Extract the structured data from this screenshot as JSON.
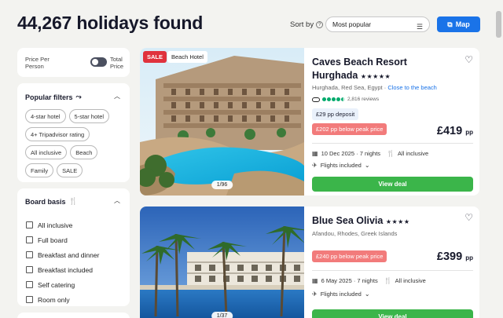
{
  "header": {
    "title": "44,267 holidays found",
    "sort_label": "Sort by",
    "sort_value": "Most popular",
    "map_label": "Map"
  },
  "price_toggle": {
    "left_label": "Price Per Person",
    "right_label": "Total Price"
  },
  "popular_filters": {
    "title": "Popular filters",
    "chips": [
      "4-star hotel",
      "5-star hotel",
      "4+ Tripadvisor rating",
      "All inclusive",
      "Beach",
      "Family",
      "SALE"
    ]
  },
  "board_basis": {
    "title": "Board basis",
    "options": [
      "All inclusive",
      "Full board",
      "Breakfast and dinner",
      "Breakfast included",
      "Self catering",
      "Room only"
    ]
  },
  "results": [
    {
      "sale_badge": "SALE",
      "type_badge": "Beach Hotel",
      "image_counter": "1/96",
      "name_line1": "Caves Beach Resort",
      "name_line2": "Hurghada",
      "stars": "★★★★★",
      "location": "Hurghada, Red Sea, Egypt · ",
      "location_link": "Close to the beach",
      "review_count": "2,816 reviews",
      "rating_dots": 4.5,
      "deposit": "£29 pp deposit",
      "peak": "£202 pp below peak price",
      "price": "£419",
      "price_unit": "pp",
      "date_nights": "10 Dec 2025 · 7 nights",
      "board": "All inclusive",
      "flights": "Flights included",
      "cta": "View deal"
    },
    {
      "image_counter": "1/37",
      "name_line1": "Blue Sea Olivia",
      "stars": "★★★★",
      "location": "Afandou, Rhodes, Greek Islands",
      "peak": "£240 pp below peak price",
      "price": "£399",
      "price_unit": "pp",
      "date_nights": "6 May 2025 · 7 nights",
      "board": "All inclusive",
      "flights": "Flights included",
      "cta": "View deal"
    }
  ],
  "colors": {
    "accent": "#1a73e8",
    "cta": "#3bb54a",
    "sale": "#e0323d",
    "peak": "#f27b7b",
    "rating": "#00aa6c"
  }
}
